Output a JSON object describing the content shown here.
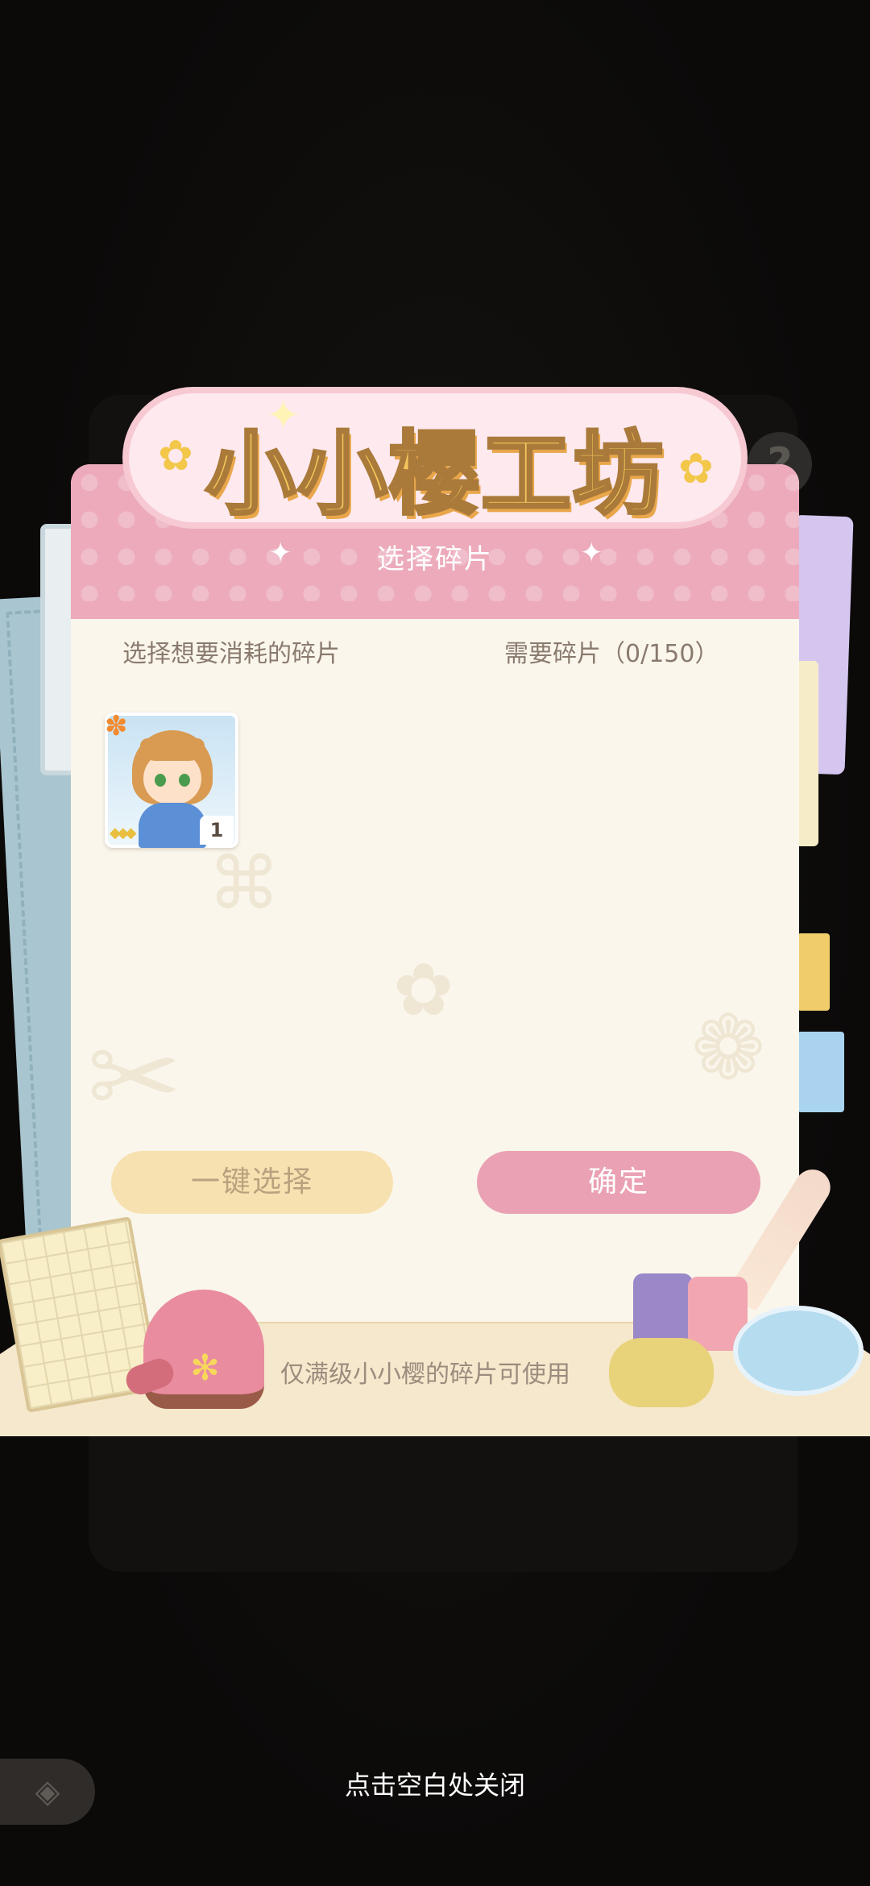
{
  "logo": {
    "title": "小小樱工坊"
  },
  "dialog": {
    "header_title": "选择碎片",
    "prompt": "选择想要消耗的碎片",
    "required": "需要碎片（0/150）",
    "items": [
      {
        "count": "1"
      }
    ],
    "buttons": {
      "select_all": "一键选择",
      "confirm": "确定"
    }
  },
  "tray": {
    "note": "仅满级小小樱的碎片可使用"
  },
  "footer": {
    "close_hint": "点击空白处关闭"
  },
  "icons": {
    "help": "question-icon",
    "back": "back-arrow-icon",
    "item_badge": "orange-flower-icon"
  },
  "colors": {
    "header_pink": "#ecaabb",
    "confirm_pink": "#eaa1b3",
    "select_yellow": "#f7e1b0",
    "panel_cream": "#faf6ec"
  }
}
